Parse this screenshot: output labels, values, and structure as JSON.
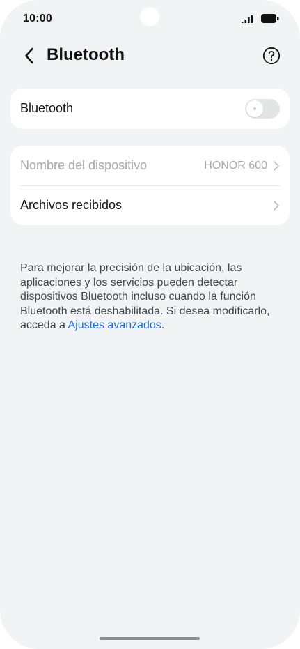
{
  "status_bar": {
    "time": "10:00"
  },
  "header": {
    "title": "Bluetooth",
    "back_icon": "chevron-left-icon",
    "help_icon": "question-circle-icon"
  },
  "bluetooth_card": {
    "label": "Bluetooth",
    "toggle_state": "off"
  },
  "device_card": {
    "device_name_label": "Nombre del dispositivo",
    "device_name_value": "HONOR 600",
    "received_files_label": "Archivos recibidos"
  },
  "info": {
    "text": "Para mejorar la precisión de la ubicación, las aplicaciones y los servicios pueden detectar dispositivos Bluetooth incluso cuando la función Bluetooth está deshabilitada. Si desea modificarlo, acceda a ",
    "link_text": "Ajustes avanzados",
    "suffix": "."
  },
  "colors": {
    "background": "#f1f3f5",
    "card": "#ffffff",
    "link": "#1f6fe0",
    "muted_text": "#a6a8ab"
  }
}
